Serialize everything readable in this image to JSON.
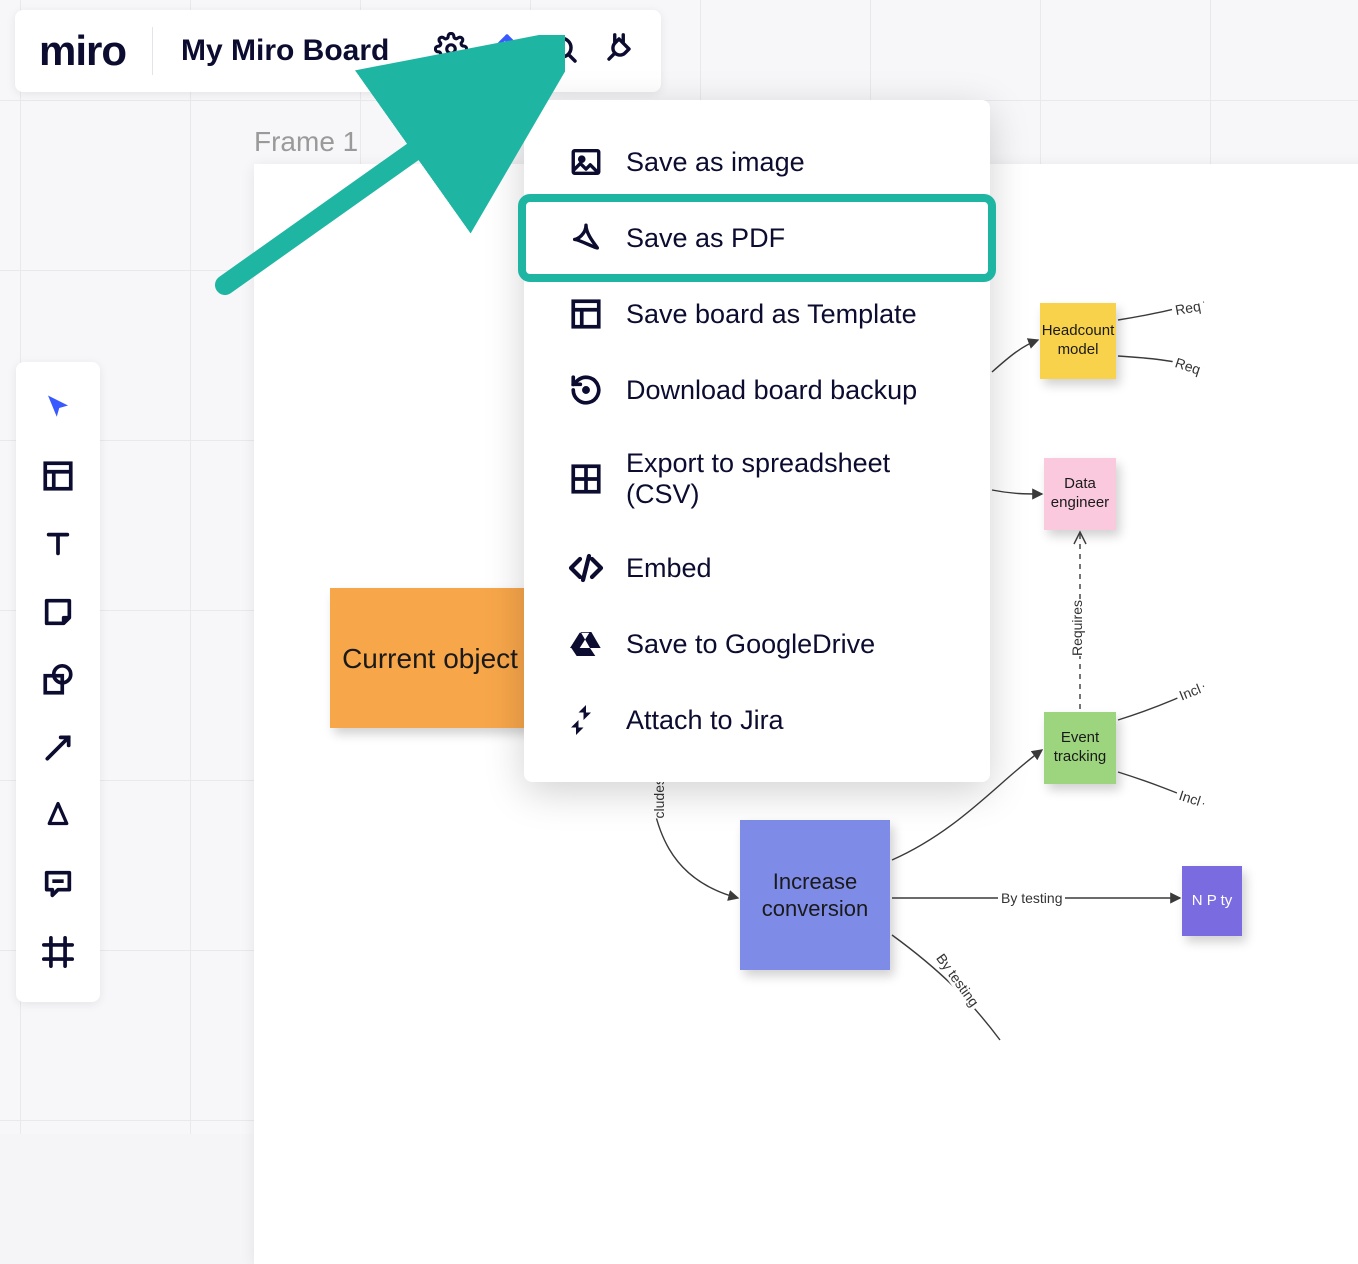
{
  "app": {
    "logo": "miro"
  },
  "board": {
    "title": "My Miro Board"
  },
  "frame": {
    "label": "Frame 1"
  },
  "export_menu": {
    "items": [
      {
        "icon": "image-icon",
        "label": "Save as image"
      },
      {
        "icon": "pdf-icon",
        "label": "Save as PDF",
        "highlighted": true
      },
      {
        "icon": "template-icon",
        "label": "Save board as Template"
      },
      {
        "icon": "backup-icon",
        "label": "Download board backup"
      },
      {
        "icon": "spreadsheet-icon",
        "label": "Export to spreadsheet (CSV)"
      },
      {
        "icon": "embed-icon",
        "label": "Embed"
      },
      {
        "icon": "google-drive-icon",
        "label": "Save to GoogleDrive"
      },
      {
        "icon": "jira-icon",
        "label": "Attach to Jira"
      }
    ]
  },
  "stickies": {
    "current_objective": "Current object",
    "increase_conversion": "Increase conversion",
    "headcount_model": "Headcount model",
    "data_engineer": "Data engineer",
    "event_tracking": "Event tracking",
    "partial_right": "N P ty"
  },
  "edges": {
    "cludes": "cludes",
    "by_testing": "By testing",
    "by_testing2": "By testing",
    "requires": "Requires",
    "includes_up": "Incl",
    "includes_down": "Incl",
    "requires_top1": "Req",
    "requires_top2": "Req"
  }
}
